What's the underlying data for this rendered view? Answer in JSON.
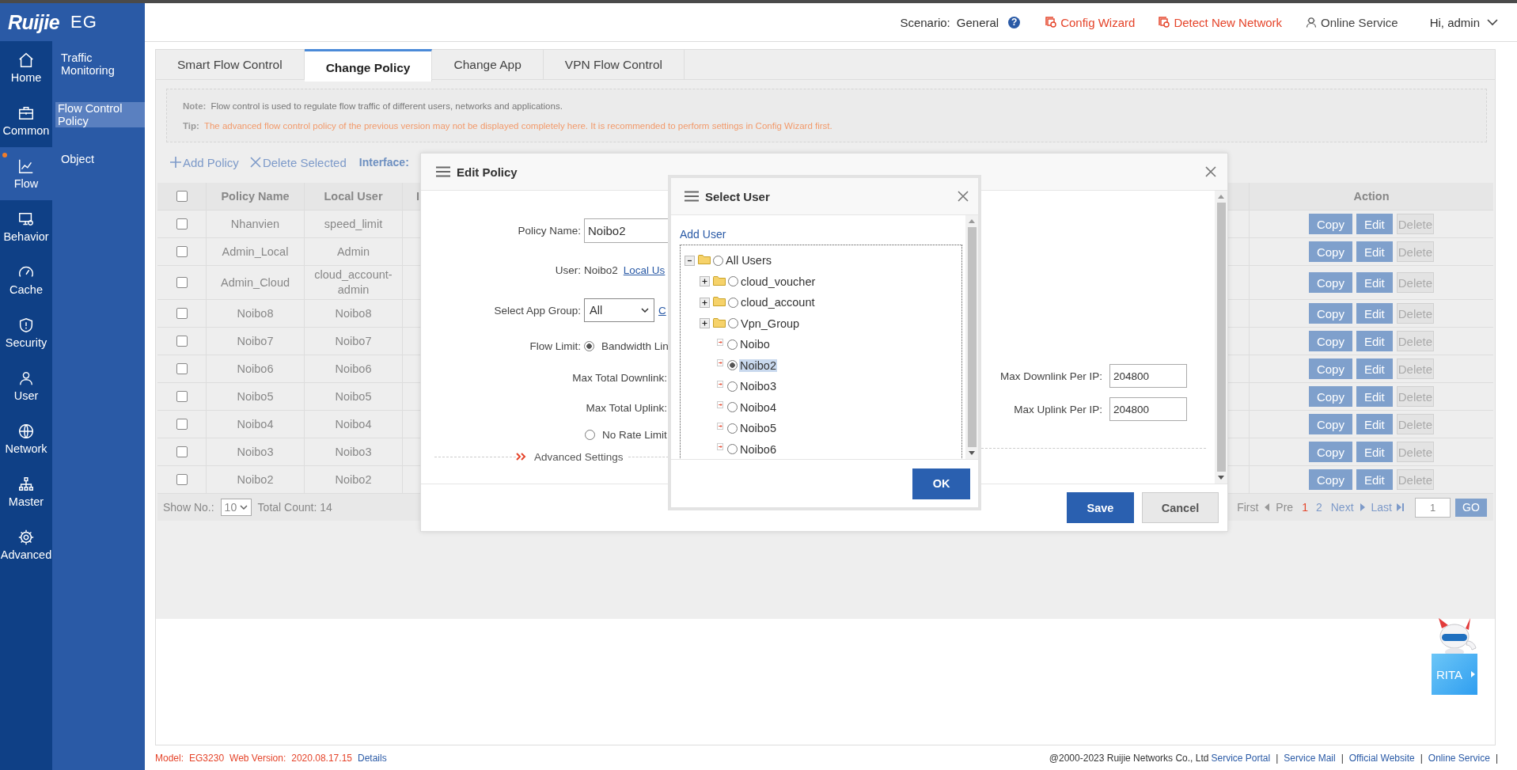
{
  "brand": {
    "logo": "Ruijie",
    "product": "EG"
  },
  "nav": [
    {
      "label": "Home",
      "selected": false,
      "alert": false
    },
    {
      "label": "Common",
      "selected": false,
      "alert": false
    },
    {
      "label": "Flow",
      "selected": true,
      "alert": true
    },
    {
      "label": "Behavior",
      "selected": false,
      "alert": false
    },
    {
      "label": "Cache",
      "selected": false,
      "alert": false
    },
    {
      "label": "Security",
      "selected": false,
      "alert": false
    },
    {
      "label": "User",
      "selected": false,
      "alert": false
    },
    {
      "label": "Network",
      "selected": false,
      "alert": false
    },
    {
      "label": "Master",
      "selected": false,
      "alert": false
    },
    {
      "label": "Advanced",
      "selected": false,
      "alert": false
    }
  ],
  "subnav": [
    {
      "label": "Traffic Monitoring",
      "selected": false
    },
    {
      "label": "Flow Control Policy",
      "selected": true
    },
    {
      "label": "Object",
      "selected": false
    }
  ],
  "header": {
    "scenario_label": "Scenario:",
    "scenario": "General",
    "help": "?",
    "links": [
      {
        "label": "Config Wizard",
        "kind": "wizard"
      },
      {
        "label": "Detect New Network",
        "kind": "wizard"
      },
      {
        "label": "Online Service",
        "kind": "service"
      }
    ],
    "user": "Hi, admin"
  },
  "tabs": [
    {
      "label": "Smart Flow Control",
      "selected": false
    },
    {
      "label": "Change Policy",
      "selected": true
    },
    {
      "label": "Change App",
      "selected": false
    },
    {
      "label": "VPN Flow Control",
      "selected": false
    }
  ],
  "notice": {
    "note_label": "Note:",
    "note": "Flow control is used to regulate flow traffic of different users, networks and applications.",
    "tip_label": "Tip:",
    "tip": "The advanced flow control policy of the previous version may not be displayed completely here. It is recommended to perform settings in Config Wizard first."
  },
  "toolbar": {
    "add": "Add Policy",
    "delete": "Delete Selected",
    "interface_label": "Interface:"
  },
  "table": {
    "select_all_checked": false,
    "columns": [
      "Policy Name",
      "Local User",
      "I",
      "Action"
    ],
    "rows": [
      {
        "checked": false,
        "policy_name": "Nhanvien",
        "local_user": "speed_limit",
        "actions": [
          {
            "label": "Copy",
            "disabled": false
          },
          {
            "label": "Edit",
            "disabled": false
          },
          {
            "label": "Delete",
            "disabled": true
          }
        ]
      },
      {
        "checked": false,
        "policy_name": "Admin_Local",
        "local_user": "Admin",
        "actions": [
          {
            "label": "Copy",
            "disabled": false
          },
          {
            "label": "Edit",
            "disabled": false
          },
          {
            "label": "Delete",
            "disabled": true
          }
        ]
      },
      {
        "checked": false,
        "policy_name": "Admin_Cloud",
        "local_user": "cloud_account-admin",
        "actions": [
          {
            "label": "Copy",
            "disabled": false
          },
          {
            "label": "Edit",
            "disabled": false
          },
          {
            "label": "Delete",
            "disabled": true
          }
        ]
      },
      {
        "checked": false,
        "policy_name": "Noibo8",
        "local_user": "Noibo8",
        "actions": [
          {
            "label": "Copy",
            "disabled": false
          },
          {
            "label": "Edit",
            "disabled": false
          },
          {
            "label": "Delete",
            "disabled": true
          }
        ]
      },
      {
        "checked": false,
        "policy_name": "Noibo7",
        "local_user": "Noibo7",
        "actions": [
          {
            "label": "Copy",
            "disabled": false
          },
          {
            "label": "Edit",
            "disabled": false
          },
          {
            "label": "Delete",
            "disabled": true
          }
        ]
      },
      {
        "checked": false,
        "policy_name": "Noibo6",
        "local_user": "Noibo6",
        "actions": [
          {
            "label": "Copy",
            "disabled": false
          },
          {
            "label": "Edit",
            "disabled": false
          },
          {
            "label": "Delete",
            "disabled": true
          }
        ]
      },
      {
        "checked": false,
        "policy_name": "Noibo5",
        "local_user": "Noibo5",
        "actions": [
          {
            "label": "Copy",
            "disabled": false
          },
          {
            "label": "Edit",
            "disabled": false
          },
          {
            "label": "Delete",
            "disabled": true
          }
        ]
      },
      {
        "checked": false,
        "policy_name": "Noibo4",
        "local_user": "Noibo4",
        "actions": [
          {
            "label": "Copy",
            "disabled": false
          },
          {
            "label": "Edit",
            "disabled": false
          },
          {
            "label": "Delete",
            "disabled": true
          }
        ]
      },
      {
        "checked": false,
        "policy_name": "Noibo3",
        "local_user": "Noibo3",
        "actions": [
          {
            "label": "Copy",
            "disabled": false
          },
          {
            "label": "Edit",
            "disabled": false
          },
          {
            "label": "Delete",
            "disabled": true
          }
        ]
      },
      {
        "checked": false,
        "policy_name": "Noibo2",
        "local_user": "Noibo2",
        "actions": [
          {
            "label": "Copy",
            "disabled": false
          },
          {
            "label": "Edit",
            "disabled": false
          },
          {
            "label": "Delete",
            "disabled": true
          }
        ]
      }
    ]
  },
  "pager": {
    "show_label": "Show No.:",
    "page_size": "10",
    "total": "Total Count: 14",
    "first": "First",
    "pre": "Pre",
    "pages": [
      {
        "label": "1",
        "selected": true
      },
      {
        "label": "2",
        "selected": false
      }
    ],
    "next": "Next",
    "last": "Last",
    "page_input": "1",
    "go": "GO"
  },
  "edit_dialog": {
    "title": "Edit Policy",
    "policy_name_label": "Policy Name:",
    "policy_name": "Noibo2",
    "user_label": "User:",
    "user": "Noibo2",
    "user_link": "Local Us",
    "app_group_label": "Select App Group:",
    "app_group": "All",
    "app_group_link": "C",
    "flow_limit_label": "Flow Limit:",
    "flow_options": [
      {
        "label": "Bandwidth Lin",
        "selected": true
      },
      {
        "label": "No Rate Limit",
        "selected": false
      }
    ],
    "max_total_downlink_label": "Max Total Downlink:",
    "max_total_uplink_label": "Max Total Uplink:",
    "advanced": "Advanced Settings",
    "max_downlink_per_ip_label": "Max Downlink Per IP:",
    "max_downlink_per_ip": "204800",
    "max_uplink_per_ip_label": "Max Uplink Per IP:",
    "max_uplink_per_ip": "204800",
    "buttons": [
      {
        "label": "Save",
        "kind": "primary"
      },
      {
        "label": "Cancel",
        "kind": "secondary"
      }
    ]
  },
  "select_user": {
    "title": "Select User",
    "add_user": "Add User",
    "tree": [
      {
        "label": "All Users",
        "kind": "root",
        "expanded": true,
        "selected": false,
        "children": [
          {
            "label": "cloud_voucher",
            "kind": "group",
            "expanded": false,
            "selected": false
          },
          {
            "label": "cloud_account",
            "kind": "group",
            "expanded": false,
            "selected": false
          },
          {
            "label": "Vpn_Group",
            "kind": "group",
            "expanded": false,
            "selected": false
          },
          {
            "label": "Noibo",
            "kind": "user",
            "selected": false
          },
          {
            "label": "Noibo2",
            "kind": "user",
            "selected": true
          },
          {
            "label": "Noibo3",
            "kind": "user",
            "selected": false
          },
          {
            "label": "Noibo4",
            "kind": "user",
            "selected": false
          },
          {
            "label": "Noibo5",
            "kind": "user",
            "selected": false
          },
          {
            "label": "Noibo6",
            "kind": "user",
            "selected": false
          }
        ]
      }
    ],
    "ok": "OK"
  },
  "footer": {
    "model_label": "Model:",
    "model": "EG3230",
    "version_label": "Web Version:",
    "version": "2020.08.17.15",
    "details": "Details",
    "copyright": "@2000-2023 Ruijie Networks Co., Ltd",
    "links": [
      {
        "label": "Service Portal",
        "separator": "|"
      },
      {
        "label": "Service Mail",
        "separator": "|"
      },
      {
        "label": "Official Website",
        "separator": "|"
      },
      {
        "label": "Online Service",
        "separator": "|"
      }
    ]
  },
  "assistant": {
    "label": "RITA"
  }
}
